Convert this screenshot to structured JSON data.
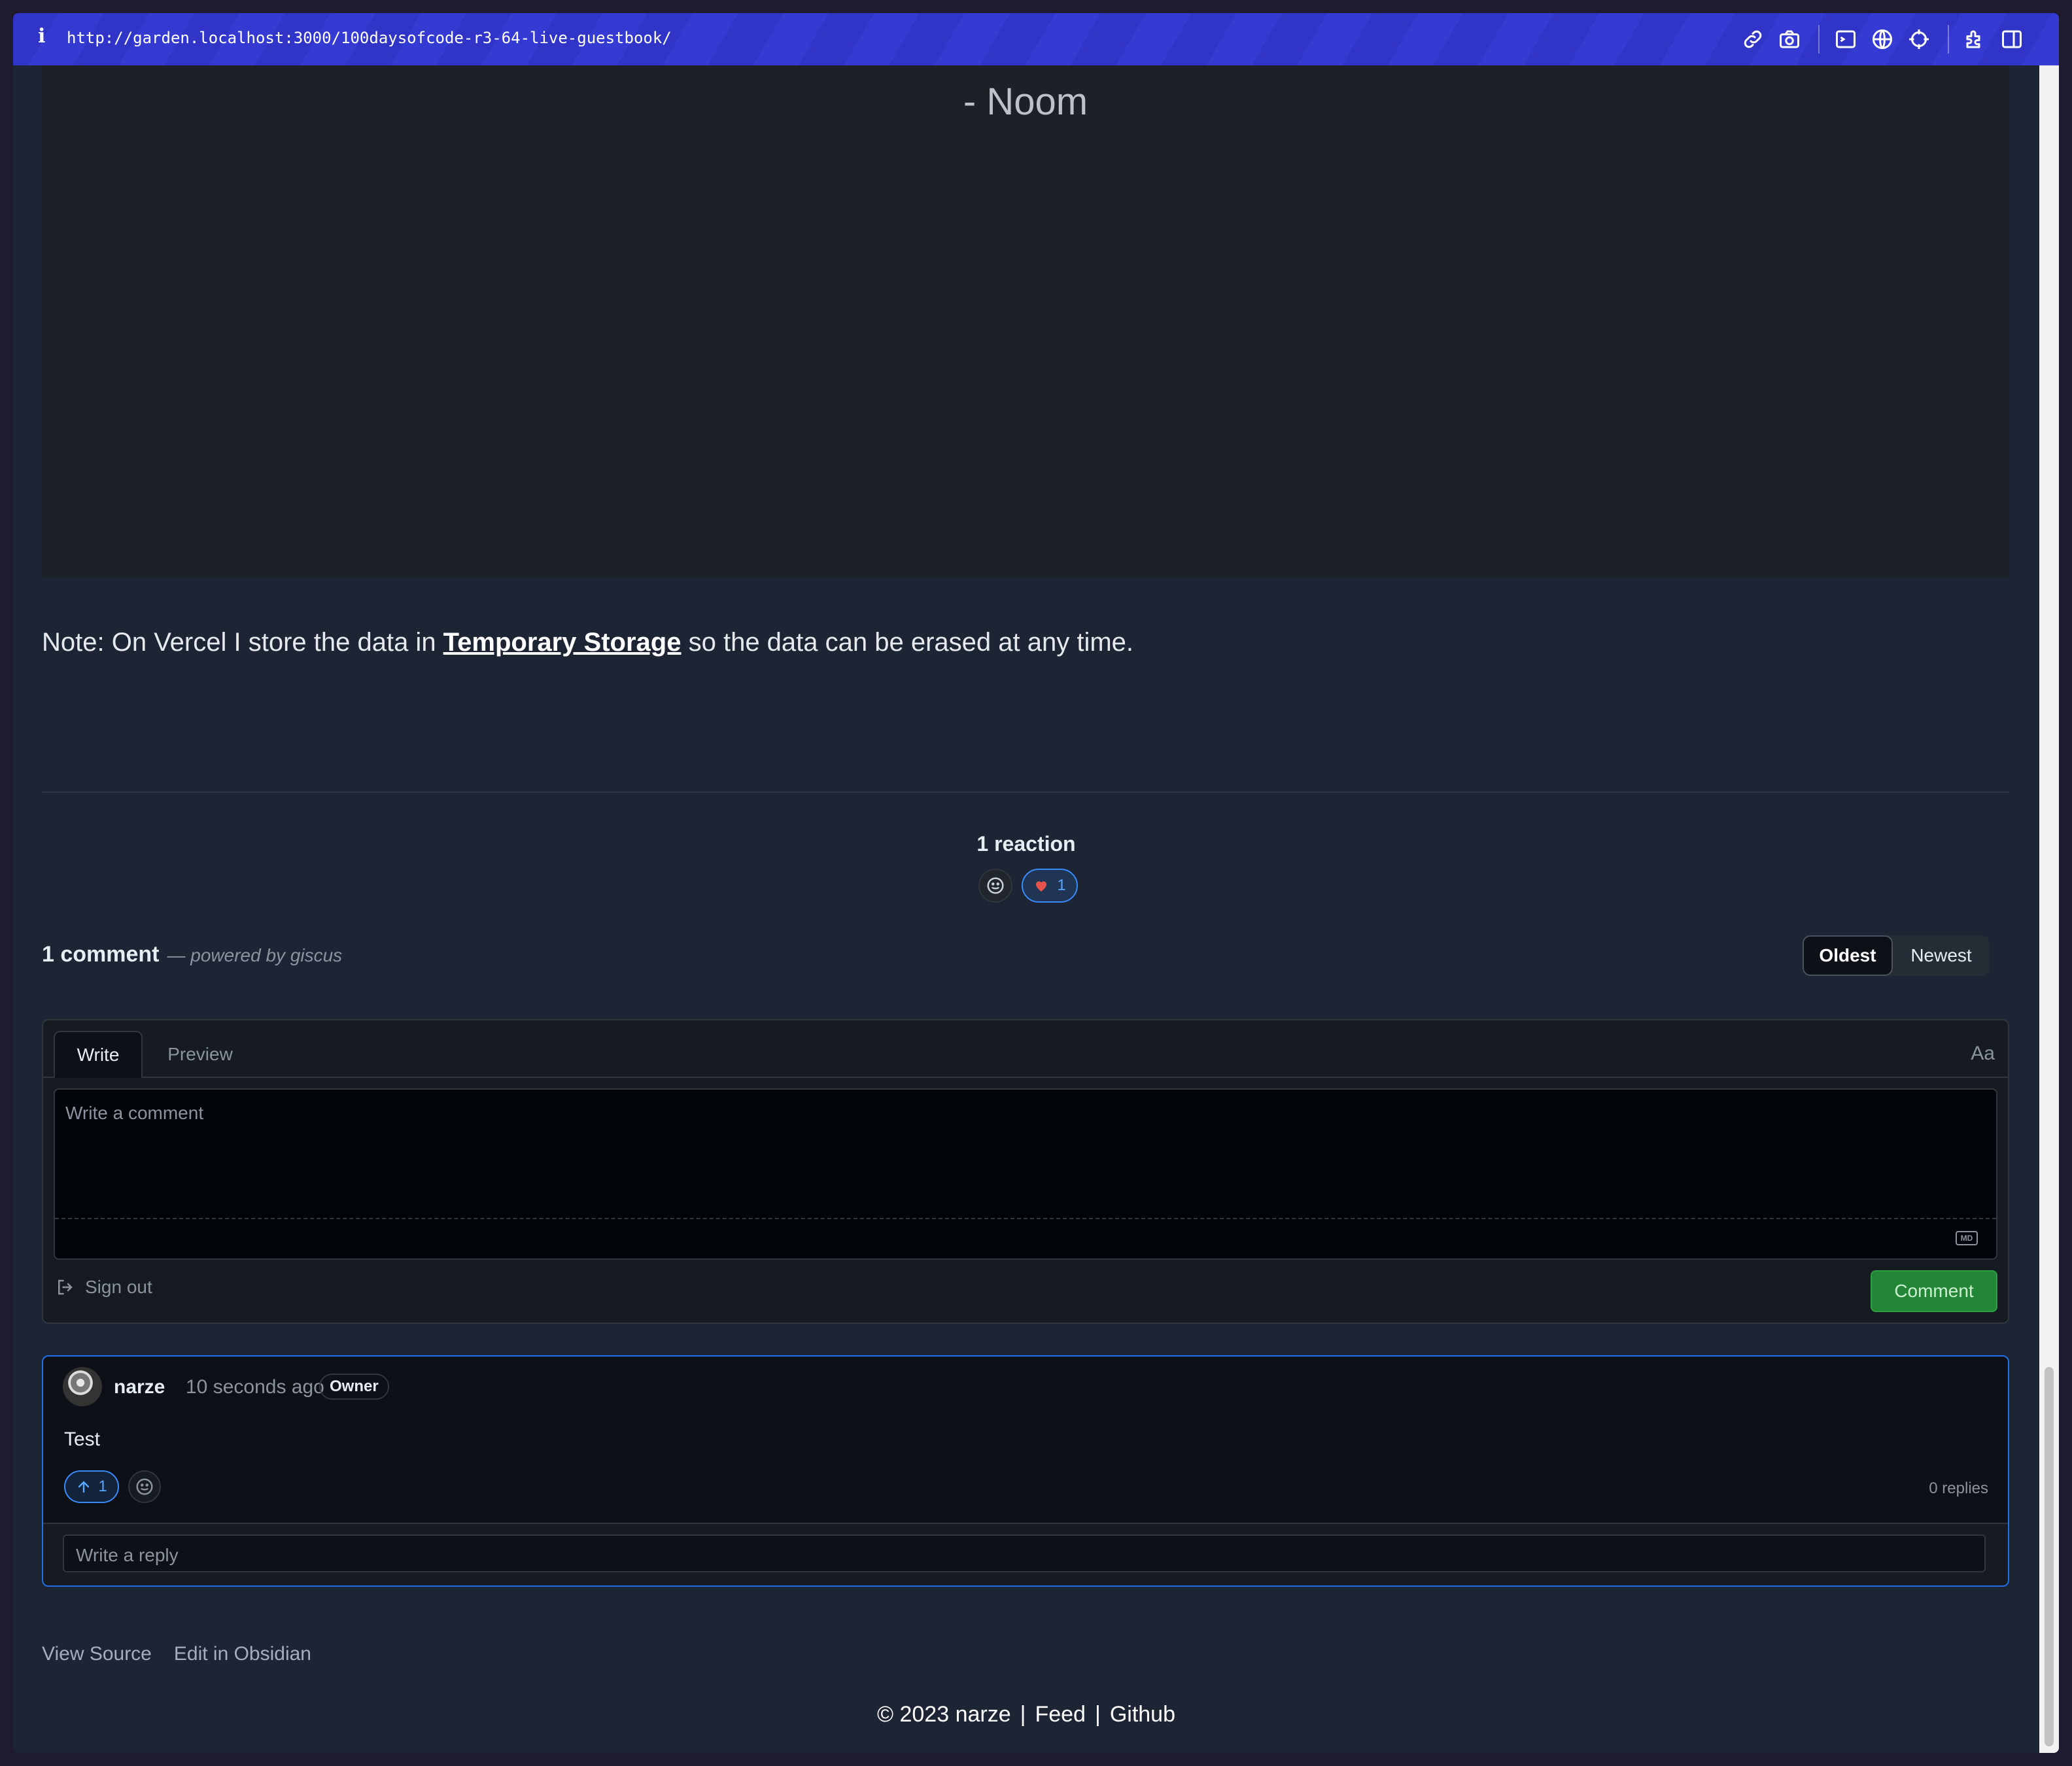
{
  "browser": {
    "info_glyph": "i",
    "url": "http://garden.localhost:3000/100daysofcode-r3-64-live-guestbook/",
    "tools": [
      "link-icon",
      "camera-icon",
      "terminal-icon",
      "globe-icon",
      "crosshair-icon",
      "extension-icon",
      "sidebar-icon"
    ]
  },
  "quote": {
    "author": "- Noom"
  },
  "note": {
    "prefix": "Note: On Vercel I store the data in ",
    "link": "Temporary Storage",
    "suffix": " so the data can be erased at any time."
  },
  "reactions": {
    "title": "1 reaction",
    "heart_count": "1"
  },
  "comments": {
    "count_label": "1 comment",
    "powered_by": "— powered by giscus",
    "sort_oldest": "Oldest",
    "sort_newest": "Newest"
  },
  "editor": {
    "tab_write": "Write",
    "tab_preview": "Preview",
    "font_toggle": "Aa",
    "placeholder": "Write a comment",
    "markdown_badge": "MD",
    "sign_out": "Sign out",
    "submit": "Comment"
  },
  "comment": {
    "author": "narze",
    "time": "10 seconds ago",
    "badge": "Owner",
    "body": "Test",
    "upvotes": "1",
    "replies": "0 replies",
    "reply_placeholder": "Write a reply"
  },
  "page_links": {
    "view_source": "View Source",
    "edit_obsidian": "Edit in Obsidian"
  },
  "footer": {
    "copyright": "© 2023 narze",
    "feed": "Feed",
    "github": "Github",
    "separator": "|"
  },
  "colors": {
    "accent_blue": "#388bfd",
    "comment_green": "#238636",
    "url_bar": "#3035c8"
  }
}
